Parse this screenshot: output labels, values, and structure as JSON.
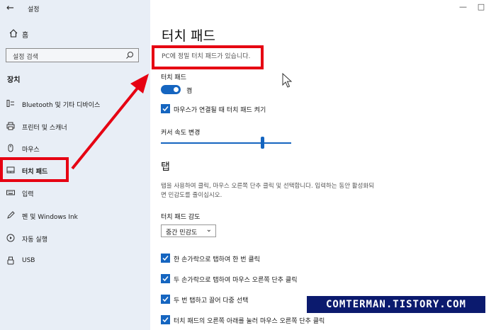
{
  "window": {
    "app_title": "설정",
    "minimize_glyph": "—",
    "maximize_glyph": "□"
  },
  "sidebar": {
    "home_label": "홈",
    "search_placeholder": "설정 검색",
    "section_heading": "장치",
    "items": [
      {
        "label": "Bluetooth 및 기타 디바이스",
        "icon": "bluetooth-icon"
      },
      {
        "label": "프린터 및 스캐너",
        "icon": "printer-icon"
      },
      {
        "label": "마우스",
        "icon": "mouse-icon"
      },
      {
        "label": "터치 패드",
        "icon": "touchpad-icon",
        "selected": true
      },
      {
        "label": "입력",
        "icon": "keyboard-icon"
      },
      {
        "label": "펜 및 Windows Ink",
        "icon": "pen-icon"
      },
      {
        "label": "자동 실행",
        "icon": "autoplay-icon"
      },
      {
        "label": "USB",
        "icon": "usb-icon"
      }
    ]
  },
  "main": {
    "title": "터치 패드",
    "info": "PC에 정밀 터치 패드가 있습니다.",
    "touchpad_label": "터치 패드",
    "toggle_state": "켬",
    "mouse_connected_checkbox": "마우스가 연결될 때 터치 패드 켜기",
    "cursor_speed_label": "커서 속도 변경",
    "cursor_speed_fraction": 0.78,
    "taps_title": "탭",
    "taps_desc": "탭을 사용하여 클릭, 마우스 오른쪽 단추 클릭 및 선택합니다. 입력하는 동안 활성화되면 민감도를 줄이십시오.",
    "sensitivity_label": "터치 패드 감도",
    "sensitivity_value": "중간 민감도",
    "tap_options": [
      "한 손가락으로 탭하여 한 번 클릭",
      "두 손가락으로 탭하여 마우스 오른쪽 단추 클릭",
      "두 번 탭하고 끌어 다중 선택",
      "터치 패드의 오른쪽 아래를 눌러 마우스 오른쪽 단추 클릭"
    ]
  },
  "watermark": "COMTERMAN.TISTORY.COM",
  "colors": {
    "accent": "#1565c0",
    "sidebar_bg": "#e8eef6",
    "annotation_red": "#e60012",
    "watermark_bg": "#0b1a6e"
  }
}
